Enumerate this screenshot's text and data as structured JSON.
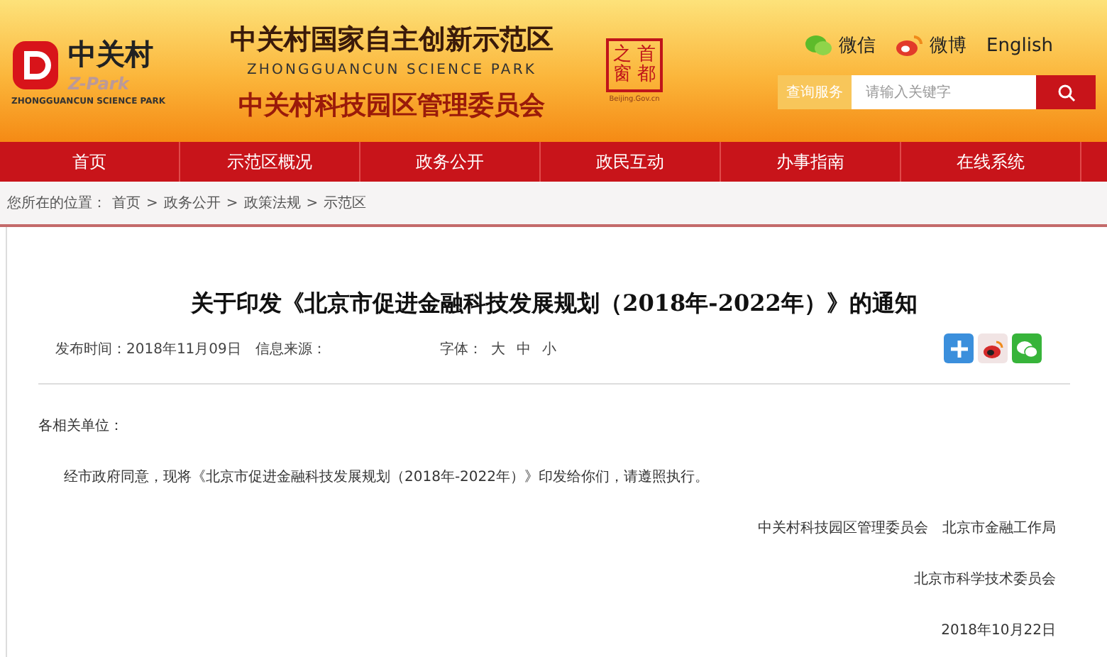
{
  "header": {
    "logo": {
      "name": "中关村",
      "brand": "Z-Park",
      "caption": "ZHONGGUANCUN SCIENCE PARK"
    },
    "title": "中关村国家自主创新示范区",
    "subtitle": "ZHONGGUANCUN SCIENCE PARK",
    "org": "中关村科技园区管理委员会",
    "seal": {
      "columns": [
        "之窗",
        "首都"
      ],
      "caption": "Beijing.Gov.cn"
    },
    "links": [
      {
        "kind": "wechat",
        "label": "微信"
      },
      {
        "kind": "weibo",
        "label": "微博"
      },
      {
        "kind": "text",
        "label": "English"
      }
    ],
    "search": {
      "label": "查询服务",
      "placeholder": "请输入关键字"
    }
  },
  "nav": [
    "首页",
    "示范区概况",
    "政务公开",
    "政民互动",
    "办事指南",
    "在线系统"
  ],
  "breadcrumb": {
    "prefix": "您所在的位置：",
    "items": [
      "首页",
      "政务公开",
      "政策法规",
      "示范区"
    ],
    "separator": ">"
  },
  "article": {
    "title": "关于印发《北京市促进金融科技发展规划（2018年-2022年）》的通知",
    "meta": {
      "date": "发布时间：2018年11月09日",
      "source": "信息来源：",
      "font_label": "字体：",
      "font_sizes": [
        "大",
        "中",
        "小"
      ]
    },
    "share": [
      {
        "kind": "plus"
      },
      {
        "kind": "weibo"
      },
      {
        "kind": "wechat"
      }
    ],
    "salutation": "各相关单位：",
    "body": "经市政府同意，现将《北京市促进金融科技发展规划（2018年-2022年）》印发给你们，请遵照执行。",
    "signatures": [
      "中关村科技园区管理委员会　北京市金融工作局",
      "北京市科学技术委员会",
      "2018年10月22日"
    ]
  }
}
